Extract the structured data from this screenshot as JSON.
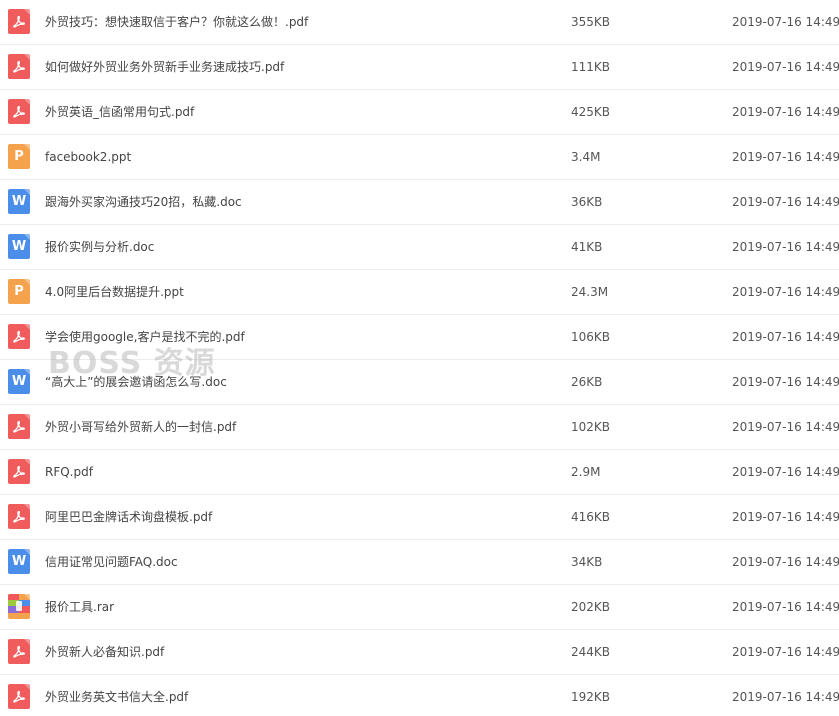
{
  "watermark": "BOSS 资源",
  "files": [
    {
      "type": "pdf",
      "glyph": "",
      "name": "外贸技巧：想快速取信于客户？你就这么做！.pdf",
      "size": "355KB",
      "date": "2019-07-16 14:49"
    },
    {
      "type": "pdf",
      "glyph": "",
      "name": "如何做好外贸业务外贸新手业务速成技巧.pdf",
      "size": "111KB",
      "date": "2019-07-16 14:49"
    },
    {
      "type": "pdf",
      "glyph": "",
      "name": "外贸英语_信函常用句式.pdf",
      "size": "425KB",
      "date": "2019-07-16 14:49"
    },
    {
      "type": "ppt",
      "glyph": "P",
      "name": "facebook2.ppt",
      "size": "3.4M",
      "date": "2019-07-16 14:49"
    },
    {
      "type": "doc",
      "glyph": "W",
      "name": "跟海外买家沟通技巧20招，私藏.doc",
      "size": "36KB",
      "date": "2019-07-16 14:49"
    },
    {
      "type": "doc",
      "glyph": "W",
      "name": "报价实例与分析.doc",
      "size": "41KB",
      "date": "2019-07-16 14:49"
    },
    {
      "type": "ppt",
      "glyph": "P",
      "name": "4.0阿里后台数据提升.ppt",
      "size": "24.3M",
      "date": "2019-07-16 14:49"
    },
    {
      "type": "pdf",
      "glyph": "",
      "name": "学会使用google,客户是找不完的.pdf",
      "size": "106KB",
      "date": "2019-07-16 14:49"
    },
    {
      "type": "doc",
      "glyph": "W",
      "name": "“高大上”的展会邀请函怎么写.doc",
      "size": "26KB",
      "date": "2019-07-16 14:49"
    },
    {
      "type": "pdf",
      "glyph": "",
      "name": "外贸小哥写给外贸新人的一封信.pdf",
      "size": "102KB",
      "date": "2019-07-16 14:49"
    },
    {
      "type": "pdf",
      "glyph": "",
      "name": "RFQ.pdf",
      "size": "2.9M",
      "date": "2019-07-16 14:49"
    },
    {
      "type": "pdf",
      "glyph": "",
      "name": "阿里巴巴金牌话术询盘模板.pdf",
      "size": "416KB",
      "date": "2019-07-16 14:49"
    },
    {
      "type": "doc",
      "glyph": "W",
      "name": "信用证常见问题FAQ.doc",
      "size": "34KB",
      "date": "2019-07-16 14:49"
    },
    {
      "type": "rar",
      "glyph": "",
      "name": "报价工具.rar",
      "size": "202KB",
      "date": "2019-07-16 14:49"
    },
    {
      "type": "pdf",
      "glyph": "",
      "name": "外贸新人必备知识.pdf",
      "size": "244KB",
      "date": "2019-07-16 14:49"
    },
    {
      "type": "pdf",
      "glyph": "",
      "name": "外贸业务英文书信大全.pdf",
      "size": "192KB",
      "date": "2019-07-16 14:49"
    }
  ]
}
